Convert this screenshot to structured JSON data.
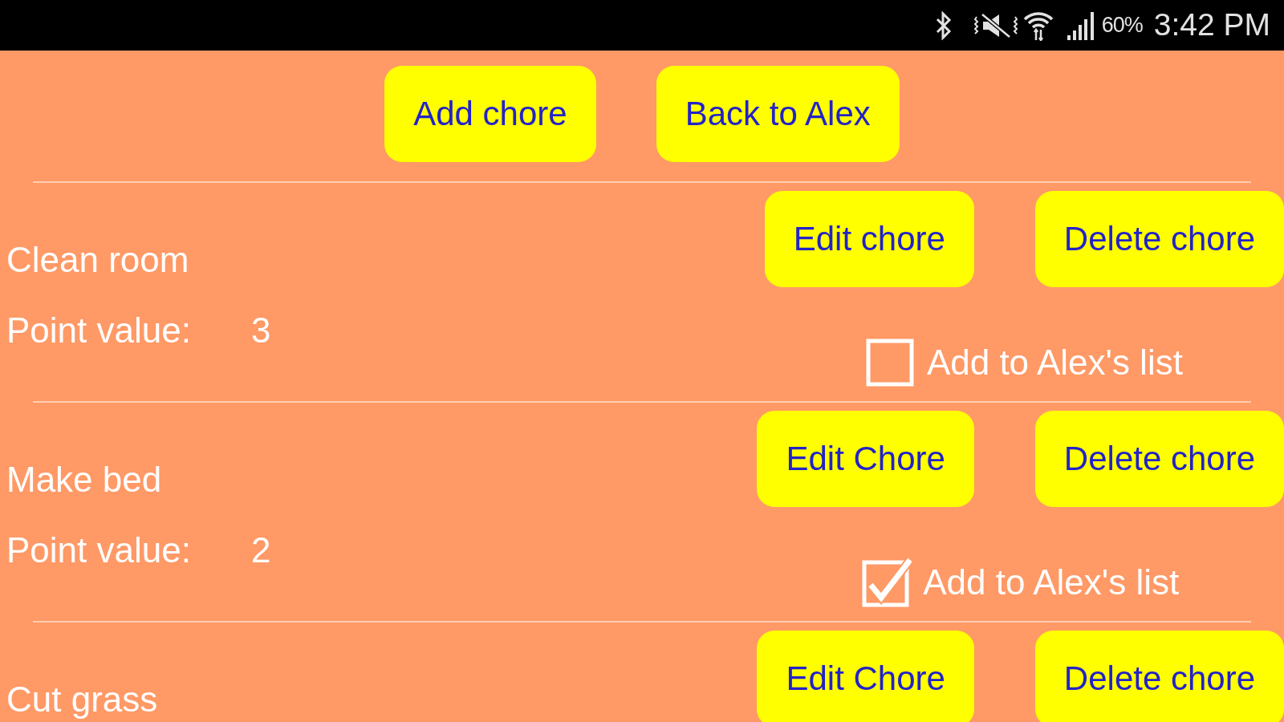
{
  "status_bar": {
    "battery": "60%",
    "time": "3:42 PM"
  },
  "top_buttons": [
    "Add chore",
    "Back to Alex"
  ],
  "chores": [
    {
      "name": "Clean room",
      "point_label": "Point value:",
      "points": "3",
      "edit_button": "Edit chore",
      "delete_button": "Delete chore",
      "add_to_list": {
        "label": "Add to Alex's list",
        "checked": false
      }
    },
    {
      "name": "Make bed",
      "point_label": "Point value:",
      "points": "2",
      "edit_button": "Edit Chore",
      "delete_button": "Delete chore",
      "add_to_list": {
        "label": "Add to Alex's list",
        "checked": true
      }
    },
    {
      "name": "Cut grass",
      "edit_button": "Edit Chore",
      "delete_button": "Delete chore"
    }
  ]
}
